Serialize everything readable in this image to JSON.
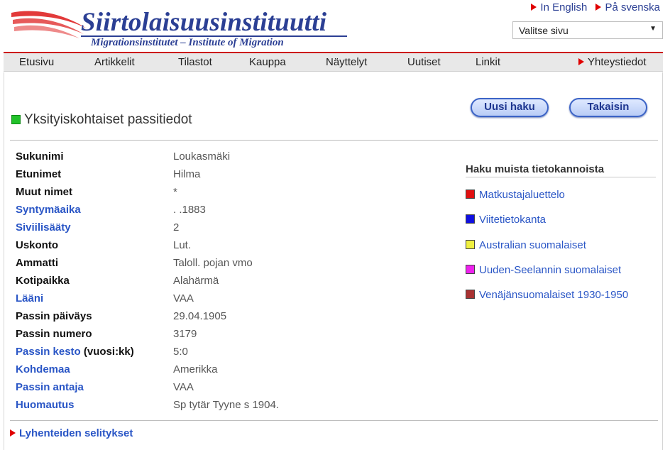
{
  "header": {
    "title": "Siirtolaisuusinstituutti",
    "subtitle": "Migrationsinstitutet – Institute of Migration",
    "lang_links": [
      "In English",
      "På svenska"
    ],
    "page_select": "Valitse sivu"
  },
  "nav": {
    "items": [
      "Etusivu",
      "Artikkelit",
      "Tilastot",
      "Kauppa",
      "Näyttelyt",
      "Uutiset",
      "Linkit"
    ],
    "contact": "Yhteystiedot"
  },
  "buttons": {
    "new_search": "Uusi haku",
    "back": "Takaisin"
  },
  "heading": "Yksityiskohtaiset passitiedot",
  "fields": [
    {
      "label": "Sukunimi",
      "value": "Loukasmäki"
    },
    {
      "label": "Etunimet",
      "value": "Hilma"
    },
    {
      "label": "Muut nimet",
      "value": "*"
    },
    {
      "label": "Syntymäaika",
      "value": ". .1883"
    },
    {
      "label": "Siviilisääty",
      "value": "2"
    },
    {
      "label": "Uskonto",
      "value": "Lut."
    },
    {
      "label": "Ammatti",
      "value": "Taloll. pojan vmo"
    },
    {
      "label": "Kotipaikka",
      "value": "Alahärmä"
    },
    {
      "label": "Lääni",
      "value": "VAA"
    },
    {
      "label": "Passin päiväys",
      "value": "29.04.1905"
    },
    {
      "label": "Passin numero",
      "value": "3179"
    },
    {
      "label": "Passin kesto",
      "label_suffix": "(vuosi:kk)",
      "value": "5:0"
    },
    {
      "label": "Kohdemaa",
      "value": "Amerikka"
    },
    {
      "label": "Passin antaja",
      "value": "VAA"
    },
    {
      "label": "Huomautus",
      "value": "Sp tytär Tyyne s 1904."
    }
  ],
  "other_databases": {
    "title": "Haku muista tietokannoista",
    "items": [
      {
        "label": "Matkustajaluettelo",
        "color": "#e01010"
      },
      {
        "label": "Viitetietokanta",
        "color": "#1010e0"
      },
      {
        "label": "Australian suomalaiset",
        "color": "#f0f040"
      },
      {
        "label": "Uuden-Seelannin suomalaiset",
        "color": "#ee22ee"
      },
      {
        "label": "Venäjänsuomalaiset 1930-1950",
        "color": "#a83232"
      }
    ]
  },
  "footer_link": "Lyhenteiden selitykset"
}
